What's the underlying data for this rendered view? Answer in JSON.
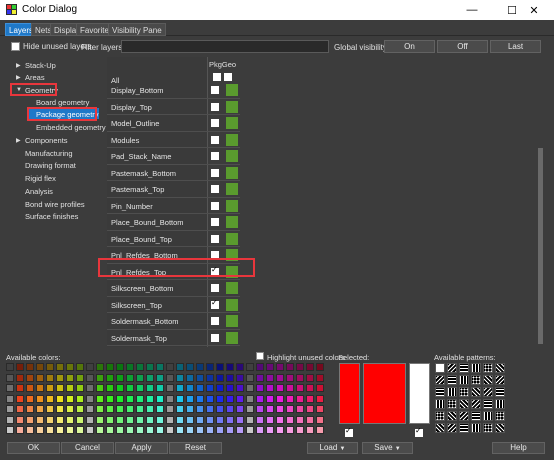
{
  "window": {
    "title": "Color Dialog",
    "minimize": "—",
    "maximize": "☐",
    "close": "✕"
  },
  "tabs": [
    {
      "label": "Layers",
      "active": true
    },
    {
      "label": "Nets",
      "active": false
    },
    {
      "label": "Display",
      "active": false
    },
    {
      "label": "Favorites",
      "active": false
    },
    {
      "label": "Visibility Pane",
      "active": false
    }
  ],
  "controls": {
    "hide_unused_label": "Hide unused layers",
    "filter_label": "Filter layers:",
    "filter_value": "",
    "global_visibility_label": "Global visibility:",
    "on_label": "On",
    "off_label": "Off",
    "last_label": "Last"
  },
  "tree": [
    {
      "label": "Stack-Up",
      "expandable": true,
      "expanded": false
    },
    {
      "label": "Areas",
      "expandable": true,
      "expanded": false
    },
    {
      "label": "Geometry",
      "expandable": true,
      "expanded": true
    },
    {
      "label": "Board geometry",
      "child": true
    },
    {
      "label": "Package geometry",
      "child": true,
      "selected": true
    },
    {
      "label": "Embedded geometry",
      "child": true
    },
    {
      "label": "Components",
      "expandable": true,
      "expanded": false
    },
    {
      "label": "Manufacturing"
    },
    {
      "label": "Drawing format"
    },
    {
      "label": "Rigid flex"
    },
    {
      "label": "Analysis"
    },
    {
      "label": "Bond wire profiles"
    },
    {
      "label": "Surface finishes"
    }
  ],
  "grid": {
    "column_header": "PkgGeo",
    "all_label": "All",
    "layers": [
      {
        "name": "Display_Bottom",
        "visible": false
      },
      {
        "name": "Display_Top",
        "visible": false
      },
      {
        "name": "Model_Outline",
        "visible": false
      },
      {
        "name": "Modules",
        "visible": false
      },
      {
        "name": "Pad_Stack_Name",
        "visible": false
      },
      {
        "name": "Pastemask_Bottom",
        "visible": false
      },
      {
        "name": "Pastemask_Top",
        "visible": false
      },
      {
        "name": "Pin_Number",
        "visible": false
      },
      {
        "name": "Place_Bound_Bottom",
        "visible": false
      },
      {
        "name": "Place_Bound_Top",
        "visible": false
      },
      {
        "name": "Pnl_Refdes_Bottom",
        "visible": false
      },
      {
        "name": "Pnl_Refdes_Top",
        "visible": true
      },
      {
        "name": "Silkscreen_Bottom",
        "visible": false
      },
      {
        "name": "Silkscreen_Top",
        "visible": true
      },
      {
        "name": "Soldermask_Bottom",
        "visible": false
      },
      {
        "name": "Soldermask_Top",
        "visible": false
      }
    ],
    "layer_color": "#5a9b2e"
  },
  "bottom": {
    "available_colors_label": "Available colors:",
    "highlight_unused_label": "Highlight unused colors",
    "selected_label": "Selected:",
    "available_patterns_label": "Available patterns:",
    "selected_color": "#ff0000"
  },
  "footer": {
    "ok": "OK",
    "cancel": "Cancel",
    "apply": "Apply",
    "reset": "Reset",
    "load": "Load",
    "save": "Save",
    "help": "Help"
  }
}
